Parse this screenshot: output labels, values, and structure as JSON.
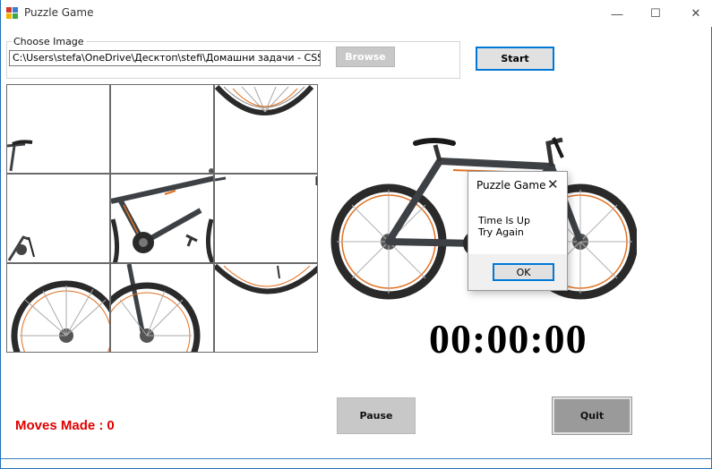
{
  "window": {
    "title": "Puzzle Game",
    "minimize_glyph": "—",
    "maximize_glyph": "☐",
    "close_glyph": "✕"
  },
  "image_chooser": {
    "group_label": "Choose Image",
    "path_value": "C:\\Users\\stefa\\OneDrive\\Десктоп\\stefi\\Домашни задачи - CSS основи\\",
    "browse_label": "Browse"
  },
  "start_label": "Start",
  "timer": "00:00:00",
  "moves": {
    "label": "Moves Made :",
    "count": "0"
  },
  "pause_label": "Pause",
  "quit_label": "Quit",
  "dialog": {
    "title": "Puzzle Game",
    "close_glyph": "✕",
    "line1": "Time Is Up",
    "line2": "Try Again",
    "ok_label": "OK"
  },
  "colors": {
    "accent": "#0078d7",
    "moves_text": "#e00000",
    "bike_frame": "#3d4145",
    "bike_orange": "#e07020"
  },
  "icons": [
    "app-icon",
    "minimize-icon",
    "maximize-icon",
    "close-icon",
    "bicycle-image"
  ]
}
